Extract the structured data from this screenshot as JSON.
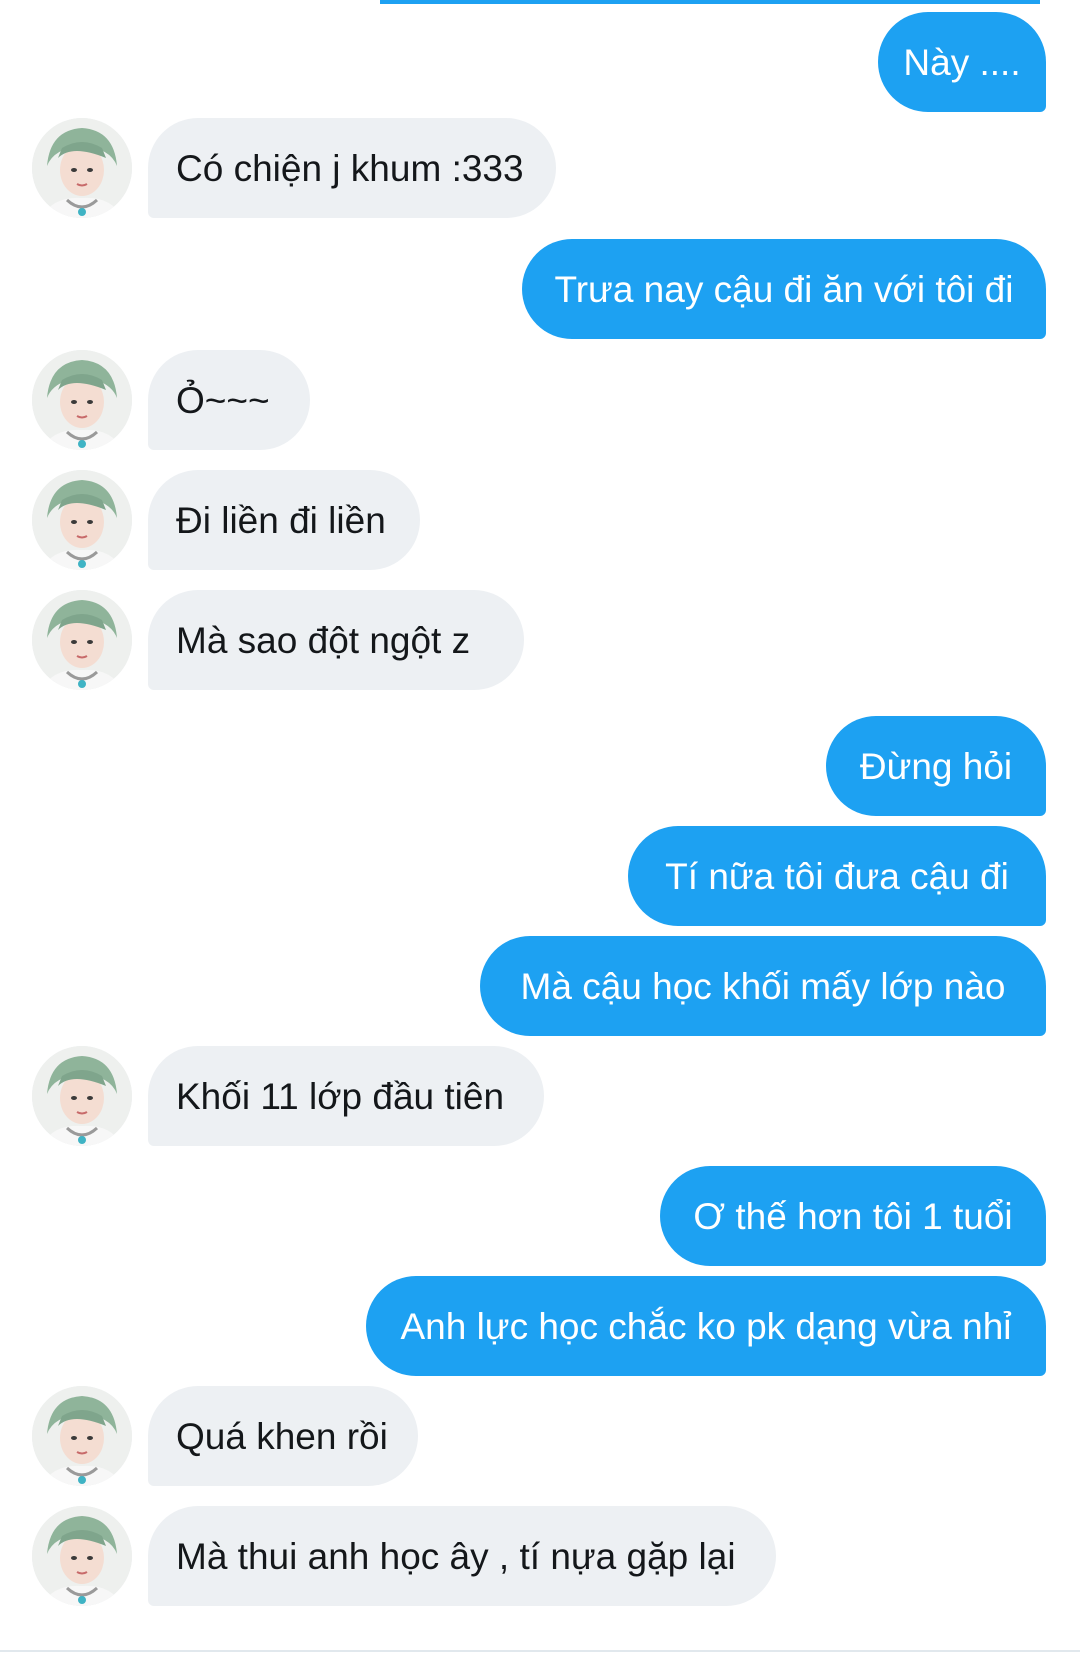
{
  "conversation": {
    "messages": [
      {
        "side": "sent",
        "text": "Này ...."
      },
      {
        "side": "recv",
        "text": "Có chiện j khum :333"
      },
      {
        "side": "sent",
        "text": "Trưa nay cậu đi ăn với tôi đi"
      },
      {
        "side": "recv",
        "text": "Ỏ~~~"
      },
      {
        "side": "recv",
        "text": "Đi liền đi liền"
      },
      {
        "side": "recv",
        "text": "Mà sao đột ngột z"
      },
      {
        "side": "sent",
        "text": "Đừng hỏi"
      },
      {
        "side": "sent",
        "text": "Tí nữa tôi đưa cậu đi"
      },
      {
        "side": "sent",
        "text": "Mà cậu học khối mấy lớp nào"
      },
      {
        "side": "recv",
        "text": "Khối 11 lớp đầu tiên"
      },
      {
        "side": "sent",
        "text": "Ơ thế hơn tôi 1 tuổi"
      },
      {
        "side": "sent",
        "text": "Anh lực học chắc ko pk dạng vừa nhỉ"
      },
      {
        "side": "recv",
        "text": "Quá khen rồi"
      },
      {
        "side": "recv",
        "text": "Mà thui anh học ây , tí nựa gặp lại"
      }
    ]
  },
  "colors": {
    "sent_bubble": "#1da1f2",
    "received_bubble": "#edf0f3",
    "sent_text": "#ffffff",
    "received_text": "#14171a"
  },
  "icons": {
    "avatar": "user-avatar-photo"
  }
}
